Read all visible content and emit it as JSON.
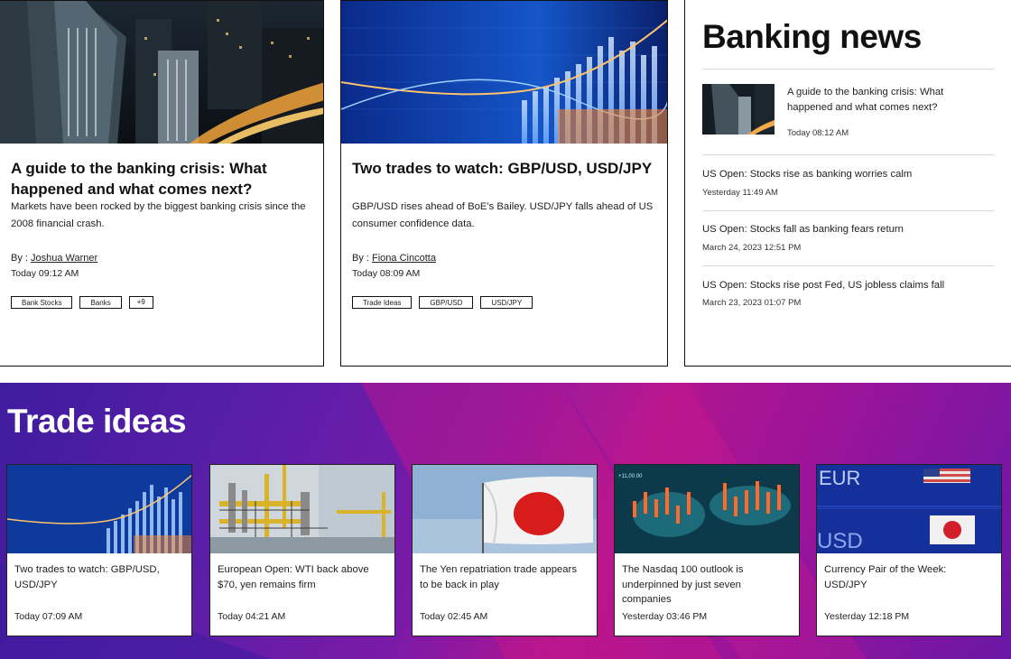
{
  "featured": [
    {
      "title": "A guide to the banking crisis: What happened and what comes next?",
      "description": "Markets have been rocked by the biggest banking crisis since the 2008 financial crash.",
      "by_prefix": "By : ",
      "author": "Joshua Warner",
      "time": "Today 09:12 AM",
      "tags": [
        "Bank Stocks",
        "Banks",
        "+9"
      ]
    },
    {
      "title": "Two trades to watch: GBP/USD, USD/JPY",
      "description": "GBP/USD rises ahead of BoE's Bailey. USD/JPY falls ahead of US consumer confidence data.",
      "by_prefix": "By : ",
      "author": "Fiona Cincotta",
      "time": "Today 08:09 AM",
      "tags": [
        "Trade Ideas",
        "GBP/USD",
        "USD/JPY"
      ]
    }
  ],
  "banking_news": {
    "heading": "Banking news",
    "featured": {
      "title": "A guide to the banking crisis: What happened and what comes next?",
      "time": "Today 08:12 AM"
    },
    "items": [
      {
        "title": "US Open: Stocks rise as banking worries calm",
        "time": "Yesterday 11:49 AM"
      },
      {
        "title": "US Open: Stocks fall as banking fears return",
        "time": "March 24, 2023 12:51 PM"
      },
      {
        "title": "US Open: Stocks rise post Fed, US jobless claims fall",
        "time": "March 23, 2023 01:07 PM"
      }
    ]
  },
  "trade_ideas": {
    "heading": "Trade ideas",
    "cards": [
      {
        "title": "Two trades to watch: GBP/USD, USD/JPY",
        "time": "Today 07:09 AM"
      },
      {
        "title": "European Open: WTI back above $70, yen remains firm",
        "time": "Today 04:21 AM"
      },
      {
        "title": "The Yen repatriation trade appears to be back in play",
        "time": "Today 02:45 AM"
      },
      {
        "title": "The Nasdaq 100 outlook is underpinned by just seven companies",
        "time": "Yesterday 03:46 PM"
      },
      {
        "title": "Currency Pair of the Week: USD/JPY",
        "time": "Yesterday 12:18 PM"
      }
    ]
  },
  "colors": {
    "trade_bg_start": "#3f1c9e",
    "trade_bg_mid": "#b0158f",
    "border": "#111111"
  },
  "thumb_text": {
    "nasdaq_tick": "+11,00.00",
    "eur": "EUR",
    "usd": "USD"
  }
}
